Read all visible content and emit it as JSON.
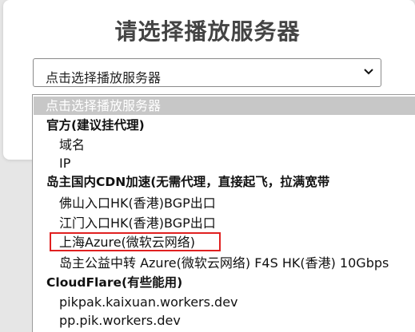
{
  "dialog": {
    "title": "请选择播放服务器"
  },
  "select": {
    "value": "点击选择播放服务器"
  },
  "dropdown": {
    "highlighted": "点击选择播放服务器",
    "groups": [
      {
        "label": "官方(建议挂代理)",
        "options": [
          "域名",
          "IP"
        ]
      },
      {
        "label": "岛主国内CDN加速(无需代理，直接起飞，拉满宽带",
        "options": [
          "佛山入口HK(香港)BGP出口",
          "江门入口HK(香港)BGP出口",
          "上海Azure(微软云网络)",
          "岛主公益中转 Azure(微软云网络) F4S HK(香港) 10Gbps"
        ]
      },
      {
        "label": "CloudFlare(有些能用)",
        "options": [
          "pikpak.kaixuan.workers.dev",
          "pp.pik.workers.dev"
        ]
      }
    ]
  },
  "annotation": {
    "color": "#e02020",
    "marked_option": "上海Azure(微软云网络)"
  }
}
